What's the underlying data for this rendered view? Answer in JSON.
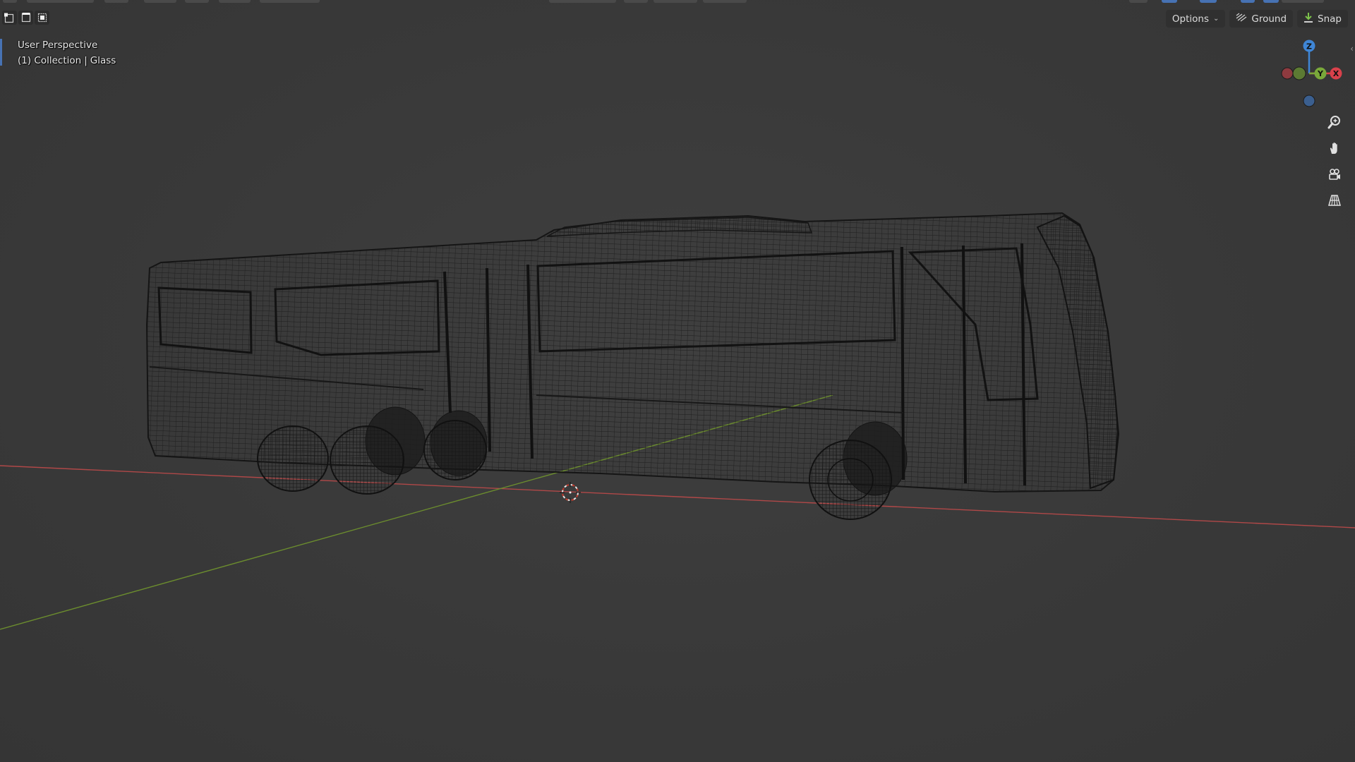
{
  "overlay": {
    "view_name": "User Perspective",
    "collection_index": "(1)",
    "collection_name": "Collection",
    "separator": "|",
    "active_object": "Glass"
  },
  "header": {
    "options_label": "Options",
    "ground_label": "Ground",
    "snap_label": "Snap"
  },
  "gizmo": {
    "z_label": "Z",
    "y_label": "Y",
    "x_label": "X",
    "colors": {
      "x": "#d9414b",
      "y": "#79a83a",
      "z": "#3f86d6",
      "neg_x": "#8e3a3f",
      "neg_y": "#5c7a33",
      "neg_z": "#3b5f8f"
    }
  },
  "scene": {
    "object": "Glass",
    "display": "wireframe",
    "grid_axis_x_color": "#b04848",
    "grid_axis_y_color": "#6b8c2e",
    "wire_color": "#1b1b1b"
  },
  "nav_tools": [
    {
      "name": "zoom-icon"
    },
    {
      "name": "pan-hand-icon"
    },
    {
      "name": "camera-view-icon"
    },
    {
      "name": "perspective-toggle-icon"
    }
  ],
  "select_modes": [
    "vertex-select-icon",
    "edge-select-icon",
    "face-select-icon"
  ]
}
